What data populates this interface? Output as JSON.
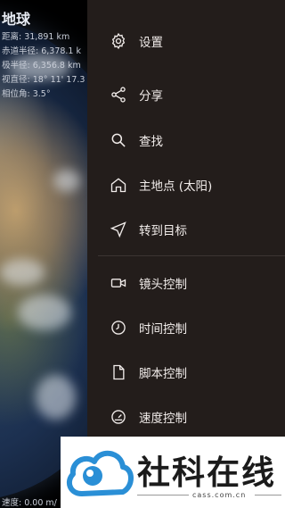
{
  "info": {
    "title": "地球",
    "distance": "距离: 31,891 km",
    "equatorial_radius": "赤道半径: 6,378.1 k",
    "polar_radius": "极半径: 6,356.8 km",
    "apparent_diameter": "视直径: 18° 11' 17.3",
    "phase_angle": "相位角: 3.5°",
    "speed": "速度: 0.00 m/"
  },
  "menu": {
    "items": [
      {
        "label": "设置",
        "icon": "gear-icon"
      },
      {
        "label": "分享",
        "icon": "share-icon"
      },
      {
        "label": "查找",
        "icon": "search-icon"
      },
      {
        "label": "主地点 (太阳)",
        "icon": "home-icon"
      },
      {
        "label": "转到目标",
        "icon": "navigate-icon"
      },
      {
        "label": "镜头控制",
        "icon": "camera-icon"
      },
      {
        "label": "时间控制",
        "icon": "clock-icon"
      },
      {
        "label": "脚本控制",
        "icon": "file-icon"
      },
      {
        "label": "速度控制",
        "icon": "speedometer-icon"
      }
    ]
  },
  "watermark": {
    "brand": "社科在线",
    "domain": "cass.com.cn"
  },
  "colors": {
    "drawer_bg": "#231d1b",
    "text": "#f1ecea",
    "watermark_blue": "#2a8fd6"
  }
}
